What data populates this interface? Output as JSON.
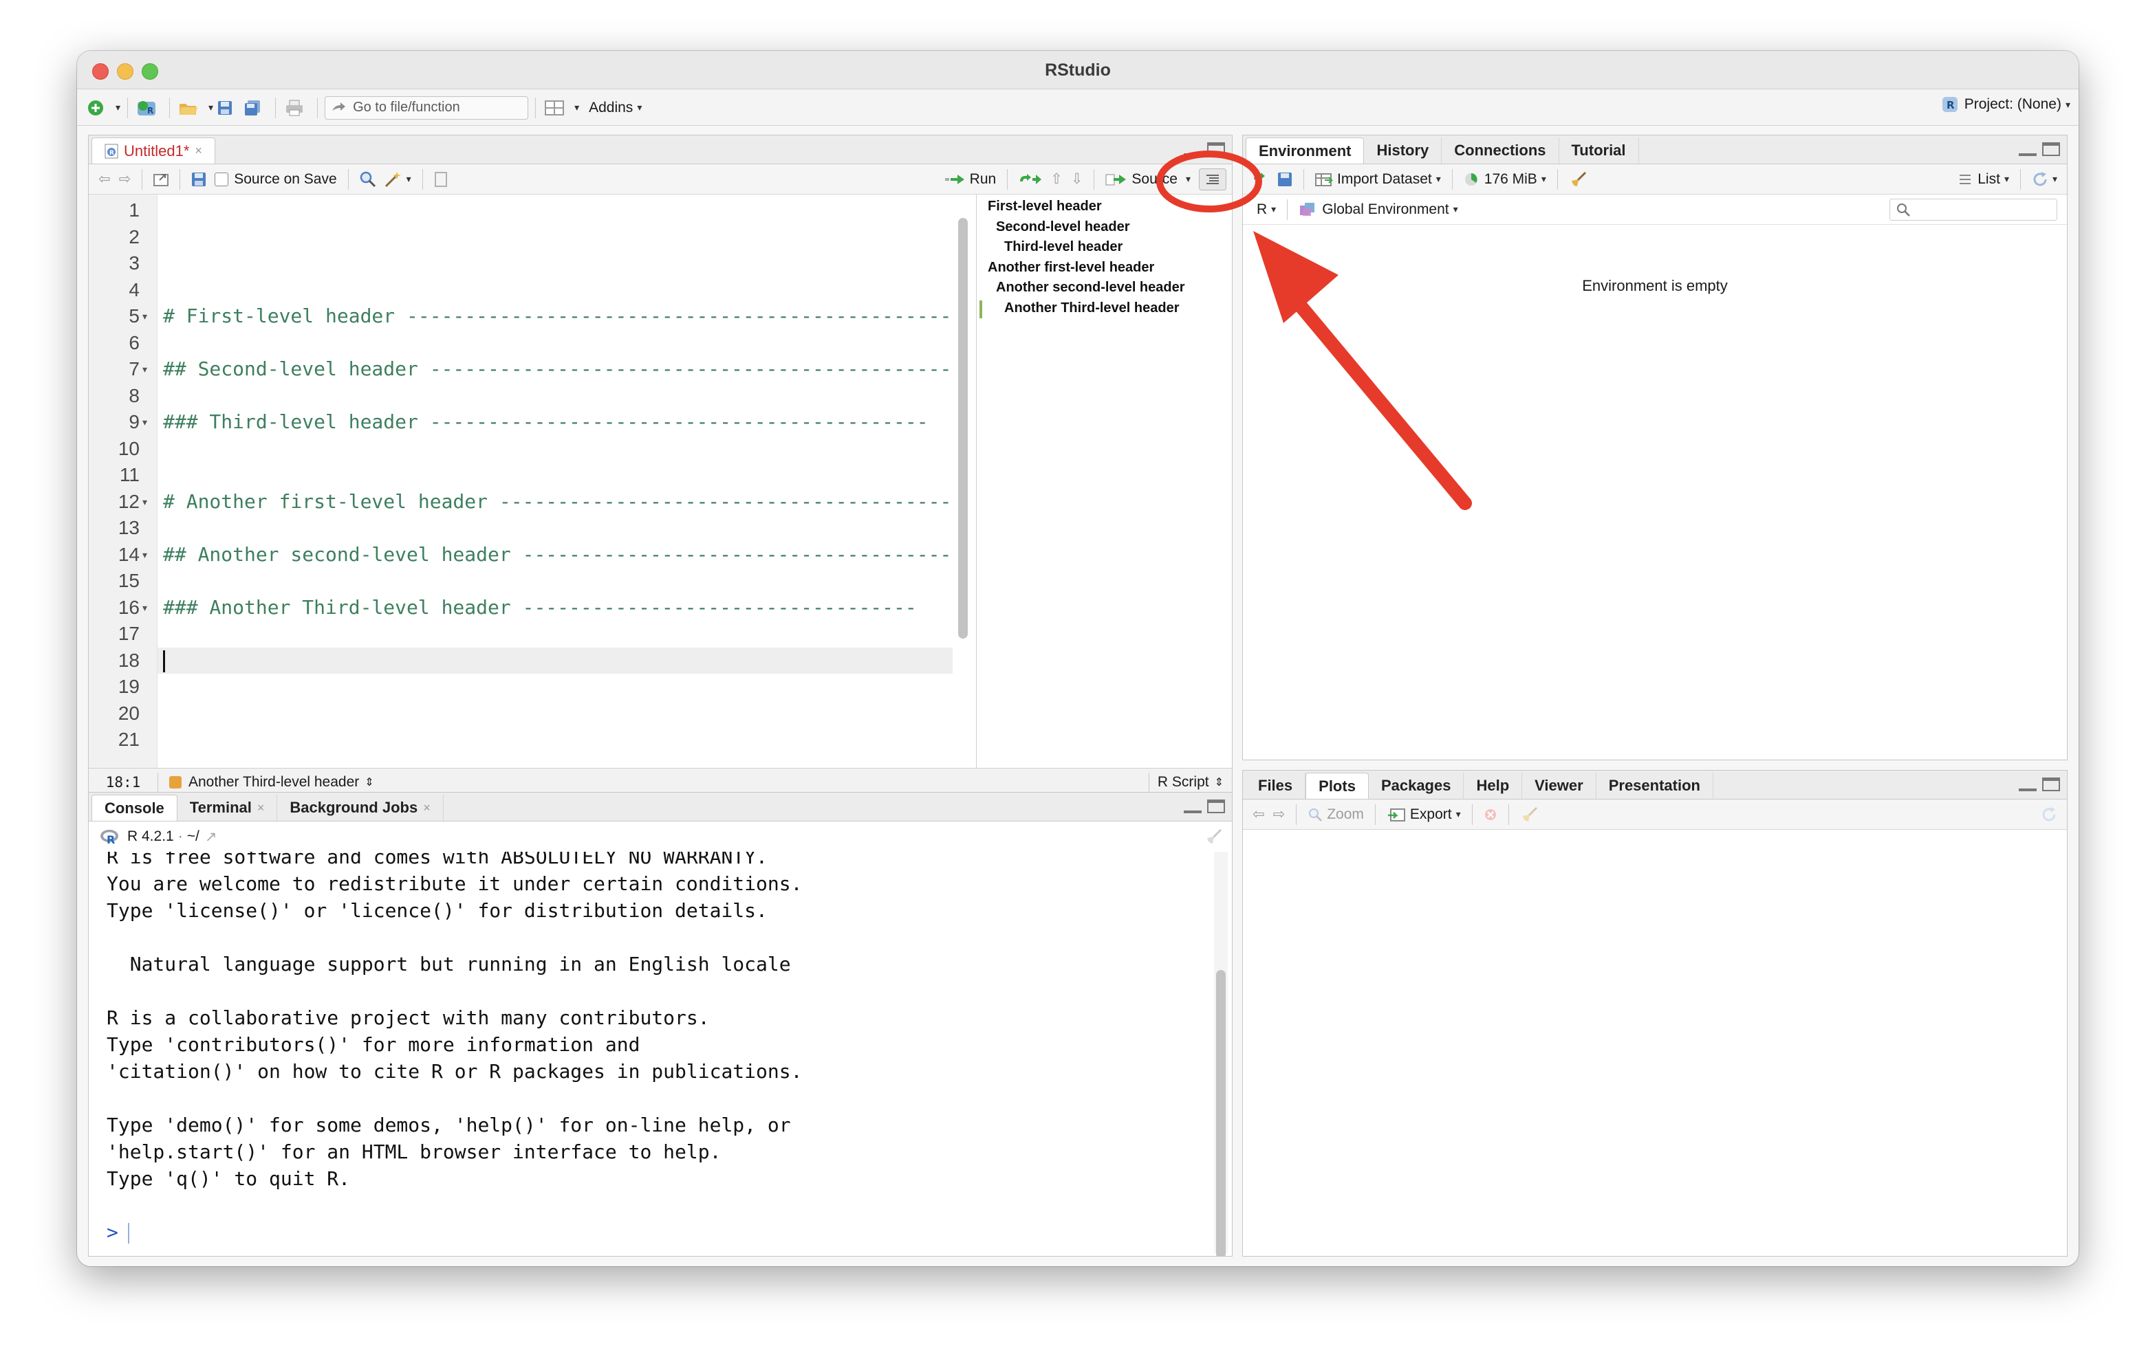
{
  "window": {
    "title": "RStudio"
  },
  "toolbar": {
    "goto_placeholder": "Go to file/function",
    "addins_label": "Addins",
    "project_label": "Project: (None)"
  },
  "editor": {
    "tab_label": "Untitled1*",
    "source_on_save_label": "Source on Save",
    "run_label": "Run",
    "source_label": "Source",
    "lines": [
      "",
      "",
      "",
      "",
      "# First-level header -------------------------------------------------",
      "",
      "## Second-level header ----------------------------------------------",
      "",
      "### Third-level header -------------------------------------------",
      "",
      "",
      "# Another first-level header -----------------------------------------",
      "",
      "## Another second-level header --------------------------------------",
      "",
      "### Another Third-level header ----------------------------------",
      "",
      "",
      "",
      "",
      ""
    ],
    "line_numbers": [
      "1",
      "2",
      "3",
      "4",
      "5",
      "6",
      "7",
      "8",
      "9",
      "10",
      "11",
      "12",
      "13",
      "14",
      "15",
      "16",
      "17",
      "18",
      "19",
      "20",
      "21"
    ],
    "outline_items": [
      "First-level header",
      "Second-level header",
      "Third-level header",
      "Another first-level header",
      "Another second-level header",
      "Another Third-level header"
    ],
    "status": {
      "position": "18:1",
      "section": "Another Third-level header",
      "filetype": "R Script"
    }
  },
  "console": {
    "tabs": [
      "Console",
      "Terminal",
      "Background Jobs"
    ],
    "r_version": "R 4.2.1",
    "path": "~/",
    "lines": [
      "R is free software and comes with ABSOLUTELY NO WARRANTY.",
      "You are welcome to redistribute it under certain conditions.",
      "Type 'license()' or 'licence()' for distribution details.",
      "",
      "  Natural language support but running in an English locale",
      "",
      "R is a collaborative project with many contributors.",
      "Type 'contributors()' for more information and",
      "'citation()' on how to cite R or R packages in publications.",
      "",
      "Type 'demo()' for some demos, 'help()' for on-line help, or",
      "'help.start()' for an HTML browser interface to help.",
      "Type 'q()' to quit R.",
      ""
    ],
    "prompt": ">"
  },
  "environment": {
    "tabs": [
      "Environment",
      "History",
      "Connections",
      "Tutorial"
    ],
    "import_label": "Import Dataset",
    "memory_label": "176 MiB",
    "list_label": "List",
    "r_label": "R",
    "scope_label": "Global Environment",
    "empty_message": "Environment is empty"
  },
  "files": {
    "tabs": [
      "Files",
      "Plots",
      "Packages",
      "Help",
      "Viewer",
      "Presentation"
    ],
    "zoom_label": "Zoom",
    "export_label": "Export"
  },
  "colors": {
    "accent_annotation": "#e63b2a",
    "comment": "#3d7f5f"
  }
}
